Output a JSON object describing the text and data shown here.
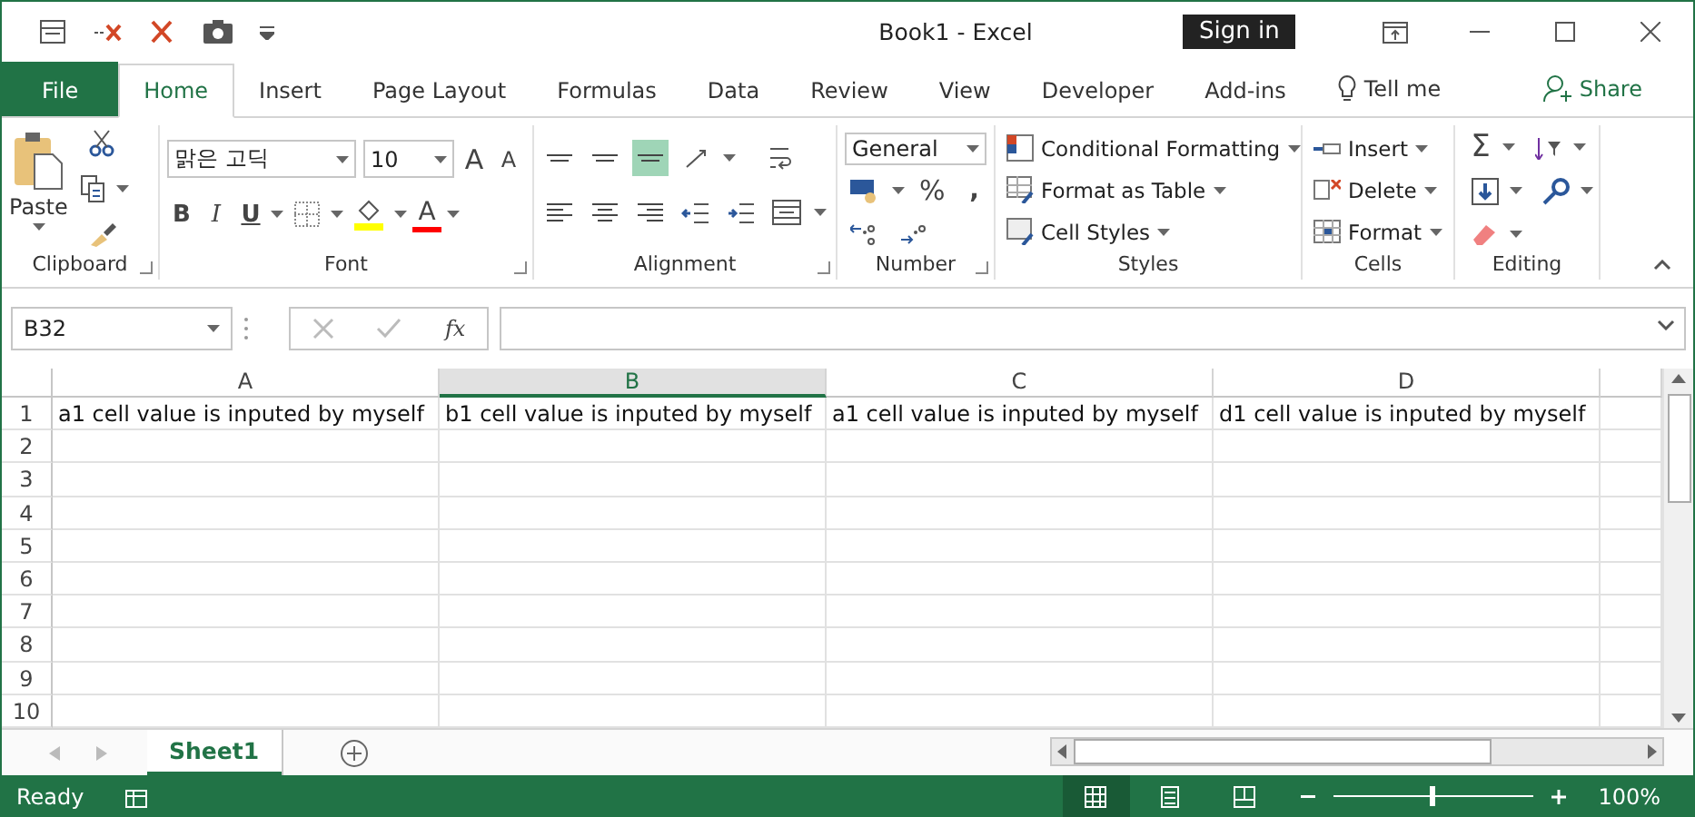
{
  "window": {
    "title": "Book1  -  Excel",
    "sign_in": "Sign in"
  },
  "tabs": [
    {
      "label": "File",
      "kind": "file",
      "selected": false
    },
    {
      "label": "Home",
      "kind": "tab",
      "selected": true
    },
    {
      "label": "Insert",
      "kind": "tab",
      "selected": false
    },
    {
      "label": "Page Layout",
      "kind": "tab",
      "selected": false
    },
    {
      "label": "Formulas",
      "kind": "tab",
      "selected": false
    },
    {
      "label": "Data",
      "kind": "tab",
      "selected": false
    },
    {
      "label": "Review",
      "kind": "tab",
      "selected": false
    },
    {
      "label": "View",
      "kind": "tab",
      "selected": false
    },
    {
      "label": "Developer",
      "kind": "tab",
      "selected": false
    },
    {
      "label": "Add-ins",
      "kind": "tab",
      "selected": false
    }
  ],
  "tell_me": "Tell me",
  "share": "Share",
  "ribbon": {
    "clipboard": {
      "label": "Clipboard",
      "paste": "Paste"
    },
    "font": {
      "label": "Font",
      "font_name": "맑은 고딕",
      "font_size": "10",
      "grow": "A",
      "shrink": "A",
      "bold": "B",
      "italic": "I",
      "underline": "U",
      "font_color": "A"
    },
    "alignment": {
      "label": "Alignment"
    },
    "number": {
      "label": "Number",
      "format": "General",
      "percent": "%",
      "comma": ","
    },
    "styles": {
      "label": "Styles",
      "items": [
        "Conditional Formatting",
        "Format as Table",
        "Cell Styles"
      ]
    },
    "cells": {
      "label": "Cells",
      "items": [
        "Insert",
        "Delete",
        "Format"
      ]
    },
    "editing": {
      "label": "Editing",
      "sum": "Σ"
    }
  },
  "formula_bar": {
    "name_box": "B32",
    "fx": "fx"
  },
  "sheet": {
    "columns": [
      {
        "label": "A",
        "selected": false
      },
      {
        "label": "B",
        "selected": true
      },
      {
        "label": "C",
        "selected": false
      },
      {
        "label": "D",
        "selected": false
      }
    ],
    "rows": [
      {
        "label": "1",
        "cells": [
          "a1 cell value is inputed by myself",
          "b1 cell value is inputed by myself",
          "a1 cell value is inputed by myself",
          "d1 cell value is inputed by myself"
        ]
      },
      {
        "label": "2",
        "cells": []
      },
      {
        "label": "3",
        "cells": []
      },
      {
        "label": "4",
        "cells": []
      },
      {
        "label": "5",
        "cells": []
      },
      {
        "label": "6",
        "cells": []
      },
      {
        "label": "7",
        "cells": []
      },
      {
        "label": "8",
        "cells": []
      },
      {
        "label": "9",
        "cells": []
      },
      {
        "label": "10",
        "cells": []
      }
    ]
  },
  "sheet_tabs": [
    {
      "label": "Sheet1",
      "selected": true
    }
  ],
  "status_bar": {
    "status": "Ready",
    "views": [
      {
        "kind": "normal",
        "selected": true
      },
      {
        "kind": "page_layout",
        "selected": false
      },
      {
        "kind": "page_break",
        "selected": false
      }
    ],
    "zoom": {
      "level": 0.5,
      "reading": "100%"
    }
  }
}
